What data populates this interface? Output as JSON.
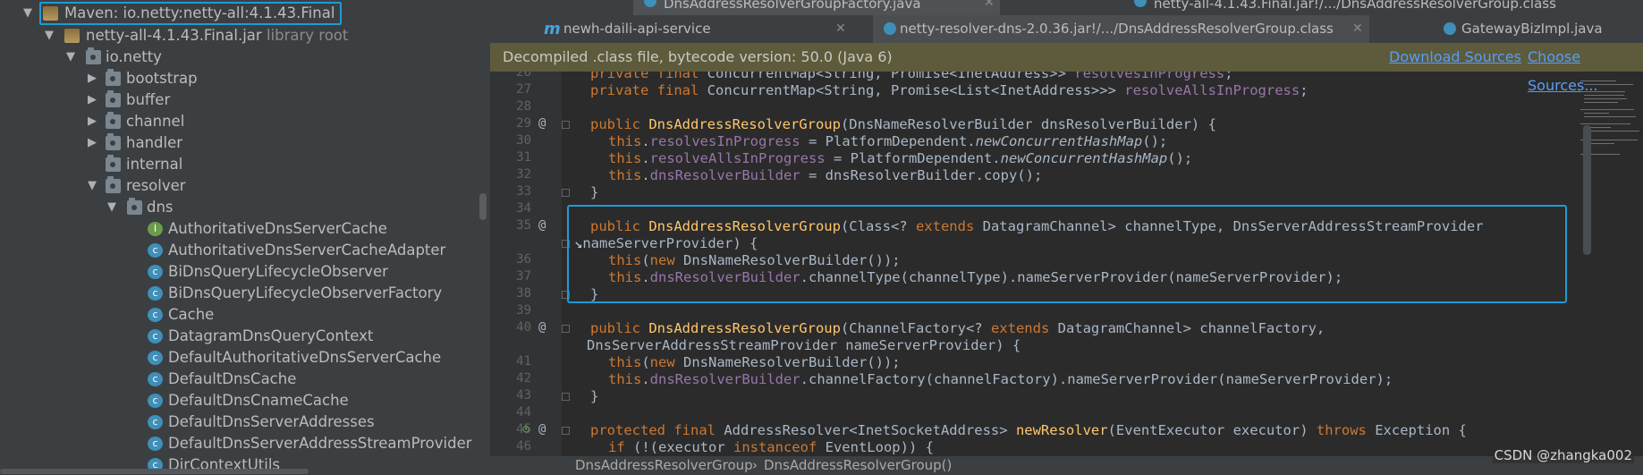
{
  "project_tree": {
    "maven_label": "Maven: io.netty:netty-all:4.1.43.Final",
    "jar_label": "netty-all-4.1.43.Final.jar",
    "jar_suffix": "library root",
    "pkg_root": "io.netty",
    "folders": [
      "bootstrap",
      "buffer",
      "channel",
      "handler",
      "internal",
      "resolver"
    ],
    "dns_label": "dns",
    "classes": [
      "AuthoritativeDnsServerCache",
      "AuthoritativeDnsServerCacheAdapter",
      "BiDnsQueryLifecycleObserver",
      "BiDnsQueryLifecycleObserverFactory",
      "Cache",
      "DatagramDnsQueryContext",
      "DefaultAuthoritativeDnsServerCache",
      "DefaultDnsCache",
      "DefaultDnsCnameCache",
      "DefaultDnsServerAddresses",
      "DefaultDnsServerAddressStreamProvider",
      "DirContextUtils"
    ]
  },
  "tabs_top": [
    "DnsAddressResolverGroupFactory.java",
    "netty-all-4.1.43.Final.jar!/.../DnsAddressResolverGroup.class"
  ],
  "tabs": [
    "newh-daili-api-service",
    "netty-resolver-dns-2.0.36.jar!/.../DnsAddressResolverGroup.class",
    "GatewayBizImpl.java"
  ],
  "banner": {
    "info": "Decompiled .class file, bytecode version: 50.0 (Java 6)",
    "download": "Download Sources",
    "choose": "Choose Sources..."
  },
  "line_numbers": [
    "26",
    "27",
    "28",
    "29",
    "30",
    "31",
    "32",
    "33",
    "34",
    "35",
    "",
    "36",
    "37",
    "38",
    "39",
    "40",
    "",
    "41",
    "42",
    "43",
    "44",
    "45",
    "46"
  ],
  "breadcrumb": [
    "DnsAddressResolverGroup",
    "DnsAddressResolverGroup()"
  ],
  "watermark": "CSDN @zhangka002",
  "accent_color": "#1e9bd7"
}
